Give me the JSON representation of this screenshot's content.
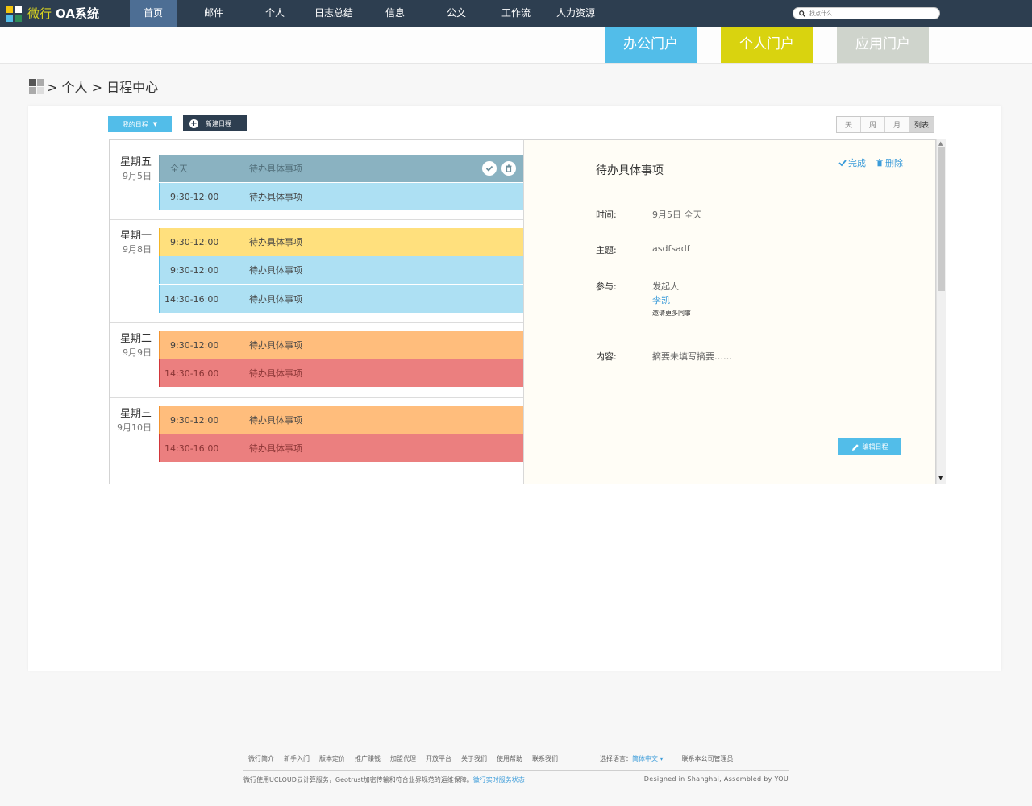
{
  "app": {
    "brand_accent": "微行",
    "brand_main": "OA系统"
  },
  "colors": {
    "topbar": "#2d3e50",
    "nav_active": "#4d6e94",
    "accent": "#52bde9",
    "link": "#3a9bd9"
  },
  "nav": [
    {
      "label": "首页",
      "active": true
    },
    {
      "label": "邮件"
    },
    {
      "label": "个人"
    },
    {
      "label": "日志总结"
    },
    {
      "label": "信息"
    },
    {
      "label": "公文"
    },
    {
      "label": "工作流"
    },
    {
      "label": "人力资源"
    }
  ],
  "search": {
    "placeholder": "找点什么……",
    "icon": "search-icon"
  },
  "portals": [
    {
      "label": "办公门户",
      "color": "#52bde9"
    },
    {
      "label": "个人门户",
      "color": "#d9d30f"
    },
    {
      "label": "应用门户",
      "color": "#cfd4cc"
    }
  ],
  "breadcrumb": {
    "text": "> 个人 > 日程中心"
  },
  "toolbar": {
    "my_schedule": "我的日程",
    "caret": "▼",
    "new_schedule": "新建日程"
  },
  "view_tabs": [
    {
      "label": "天"
    },
    {
      "label": "周"
    },
    {
      "label": "月"
    },
    {
      "label": "列表",
      "active": true
    }
  ],
  "days": [
    {
      "name": "星期五",
      "date": "9月5日",
      "events": [
        {
          "time": "全天",
          "title": "待办具体事项",
          "kind": "selected"
        },
        {
          "time": "9:30-12:00",
          "title": "待办具体事项",
          "kind": "blue"
        }
      ]
    },
    {
      "name": "星期一",
      "date": "9月8日",
      "events": [
        {
          "time": "9:30-12:00",
          "title": "待办具体事项",
          "kind": "yellow"
        },
        {
          "time": "9:30-12:00",
          "title": "待办具体事项",
          "kind": "blue"
        },
        {
          "time": "14:30-16:00",
          "title": "待办具体事项",
          "kind": "blue"
        }
      ]
    },
    {
      "name": "星期二",
      "date": "9月9日",
      "events": [
        {
          "time": "9:30-12:00",
          "title": "待办具体事项",
          "kind": "orange"
        },
        {
          "time": "14:30-16:00",
          "title": "待办具体事项",
          "kind": "red"
        }
      ]
    },
    {
      "name": "星期三",
      "date": "9月10日",
      "events": [
        {
          "time": "9:30-12:00",
          "title": "待办具体事项",
          "kind": "orange"
        },
        {
          "time": "14:30-16:00",
          "title": "待办具体事项",
          "kind": "red"
        }
      ]
    }
  ],
  "event_colors": {
    "selected": {
      "bg": "#8ab2c1",
      "border": "#7aa3b2",
      "text": "#4f6c77"
    },
    "blue": {
      "bg": "#ade0f3",
      "border": "#52bde9",
      "text": "#444444"
    },
    "yellow": {
      "bg": "#ffe07d",
      "border": "#f3b628",
      "text": "#444444"
    },
    "orange": {
      "bg": "#ffbd7c",
      "border": "#f29330",
      "text": "#444444"
    },
    "red": {
      "bg": "#eb7f7f",
      "border": "#d2363a",
      "text": "#8a3535"
    }
  },
  "detail": {
    "title": "待办具体事项",
    "complete": "完成",
    "delete": "删除",
    "time_label": "时间:",
    "time_value": "9月5日 全天",
    "subject_label": "主题:",
    "subject_value": "asdfsadf",
    "participants_label": "参与:",
    "initiator": "发起人",
    "person": "李凯",
    "invite": "邀请更多同事",
    "content_label": "内容:",
    "content_value": "摘要未填写摘要……",
    "edit": "编辑日程"
  },
  "footer": {
    "links": [
      "微行简介",
      "新手入门",
      "版本定价",
      "推广赚钱",
      "加盟代理",
      "开放平台",
      "关于我们",
      "使用帮助",
      "联系我们"
    ],
    "lang_label": "选择语言：",
    "lang_value": "简体中文 ▾",
    "admin": "联系本公司管理员",
    "note": "微行使用UCLOUD云计算服务，Geotrust加密传输和符合业界规范的运维保障。",
    "status_link": "微行实时服务状态",
    "credit": "Designed in Shanghai, Assembled by YOU"
  }
}
